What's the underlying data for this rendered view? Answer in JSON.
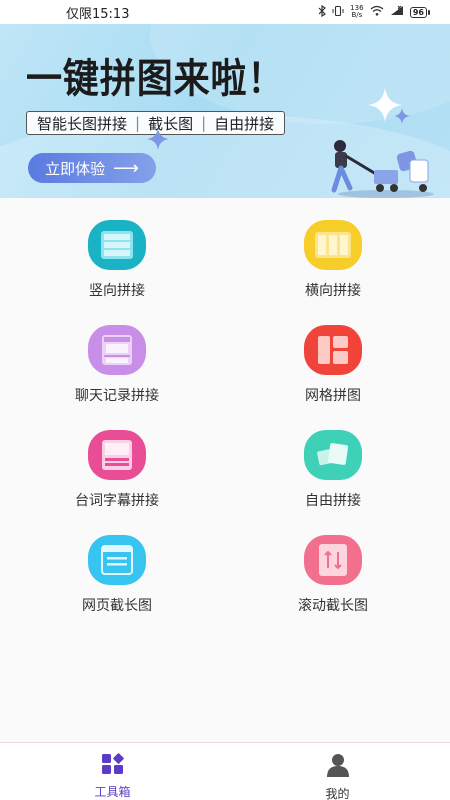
{
  "status_bar": {
    "time": "仅限15:13",
    "net_speed_value": "136",
    "net_speed_unit": "B/s",
    "battery": "96"
  },
  "banner": {
    "title": "一键拼图来啦！",
    "subtitle_items": [
      "智能长图拼接",
      "截长图",
      "自由拼接"
    ],
    "cta_label": "立即体验"
  },
  "tools": [
    {
      "label": "竖向拼接",
      "icon": "vertical-stitch-icon",
      "color": "#1ab3c6"
    },
    {
      "label": "横向拼接",
      "icon": "horizontal-stitch-icon",
      "color": "#f7cd2a"
    },
    {
      "label": "聊天记录拼接",
      "icon": "chat-record-icon",
      "color": "#c98ee8"
    },
    {
      "label": "网格拼图",
      "icon": "grid-collage-icon",
      "color": "#f0443a"
    },
    {
      "label": "台词字幕拼接",
      "icon": "subtitle-stitch-icon",
      "color": "#e84d96"
    },
    {
      "label": "自由拼接",
      "icon": "free-stitch-icon",
      "color": "#3fd1b8"
    },
    {
      "label": "网页截长图",
      "icon": "webpage-screenshot-icon",
      "color": "#38c4f0"
    },
    {
      "label": "滚动截长图",
      "icon": "scroll-screenshot-icon",
      "color": "#f2708e"
    }
  ],
  "bottom_nav": {
    "items": [
      {
        "label": "工具箱",
        "icon": "toolbox-icon",
        "active": true
      },
      {
        "label": "我的",
        "icon": "profile-icon",
        "active": false
      }
    ],
    "accent": "#5a3cc8"
  }
}
